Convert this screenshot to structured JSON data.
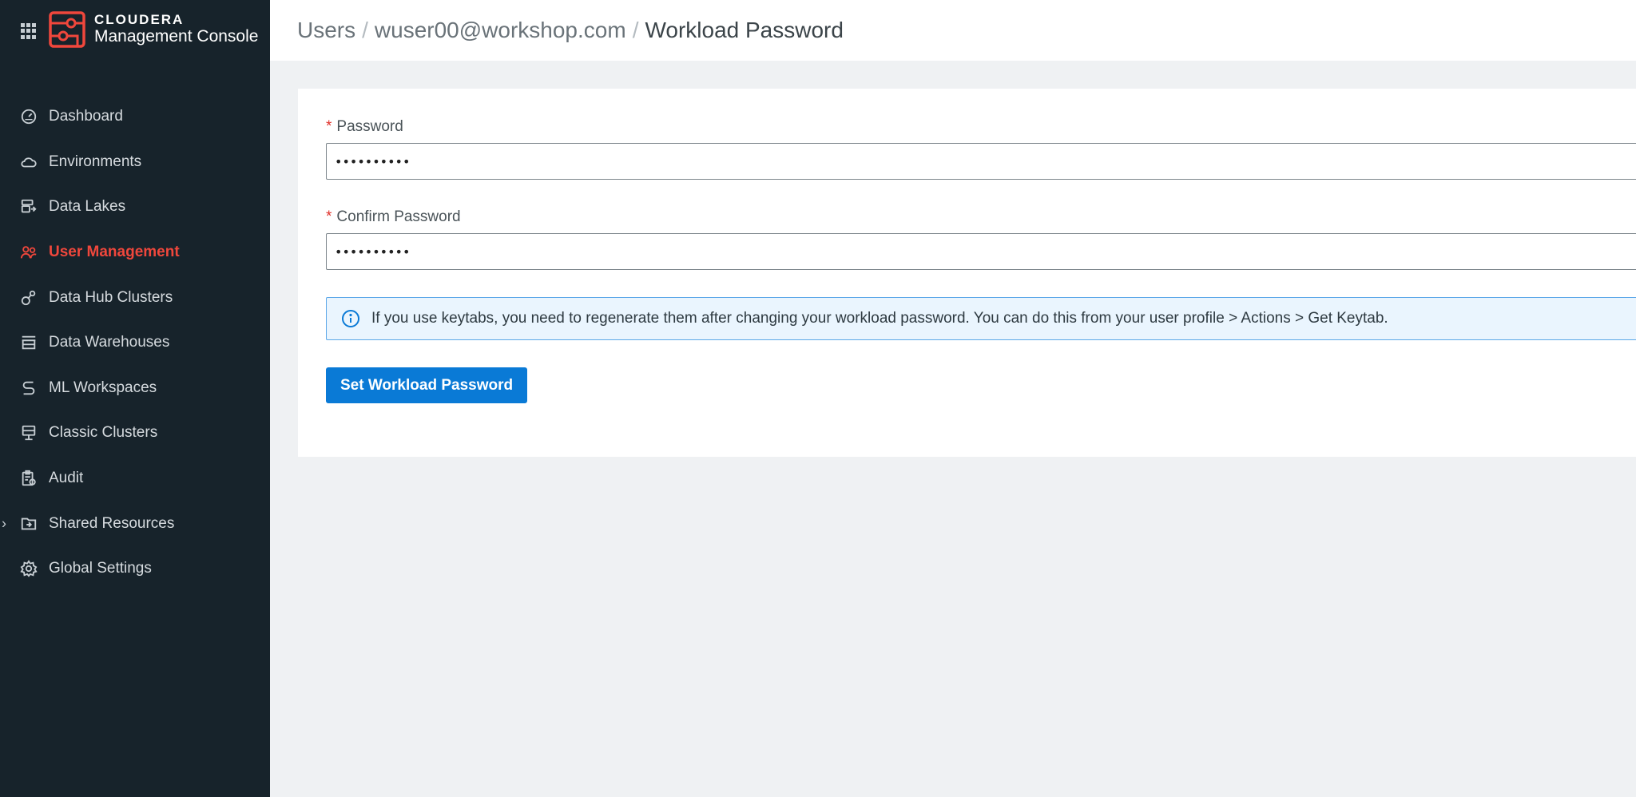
{
  "app": {
    "brand_name": "CLOUDERA",
    "brand_subtitle": "Management Console",
    "accent_color": "#f0473c"
  },
  "sidebar": {
    "items": [
      {
        "label": "Dashboard",
        "icon": "dashboard-gauge-icon",
        "active": false
      },
      {
        "label": "Environments",
        "icon": "cloud-icon",
        "active": false
      },
      {
        "label": "Data Lakes",
        "icon": "data-lake-icon",
        "active": false
      },
      {
        "label": "User Management",
        "icon": "users-icon",
        "active": true
      },
      {
        "label": "Data Hub Clusters",
        "icon": "cluster-nodes-icon",
        "active": false
      },
      {
        "label": "Data Warehouses",
        "icon": "warehouse-icon",
        "active": false
      },
      {
        "label": "ML Workspaces",
        "icon": "ml-workspace-icon",
        "active": false
      },
      {
        "label": "Classic Clusters",
        "icon": "classic-cluster-icon",
        "active": false
      },
      {
        "label": "Audit",
        "icon": "audit-clipboard-icon",
        "active": false
      },
      {
        "label": "Shared Resources",
        "icon": "folder-share-icon",
        "active": false,
        "expandable": true
      },
      {
        "label": "Global Settings",
        "icon": "gear-icon",
        "active": false
      }
    ]
  },
  "breadcrumb": {
    "root": "Users",
    "separator": "/",
    "user": "wuser00@workshop.com",
    "current": "Workload Password"
  },
  "form": {
    "required_marker": "*",
    "password_label": "Password",
    "password_value": "••••••••••",
    "confirm_label": "Confirm Password",
    "confirm_value": "••••••••••",
    "info_text": "If you use keytabs, you need to regenerate them after changing your workload password. You can do this from your user profile > Actions > Get Keytab.",
    "submit_label": "Set Workload Password"
  }
}
